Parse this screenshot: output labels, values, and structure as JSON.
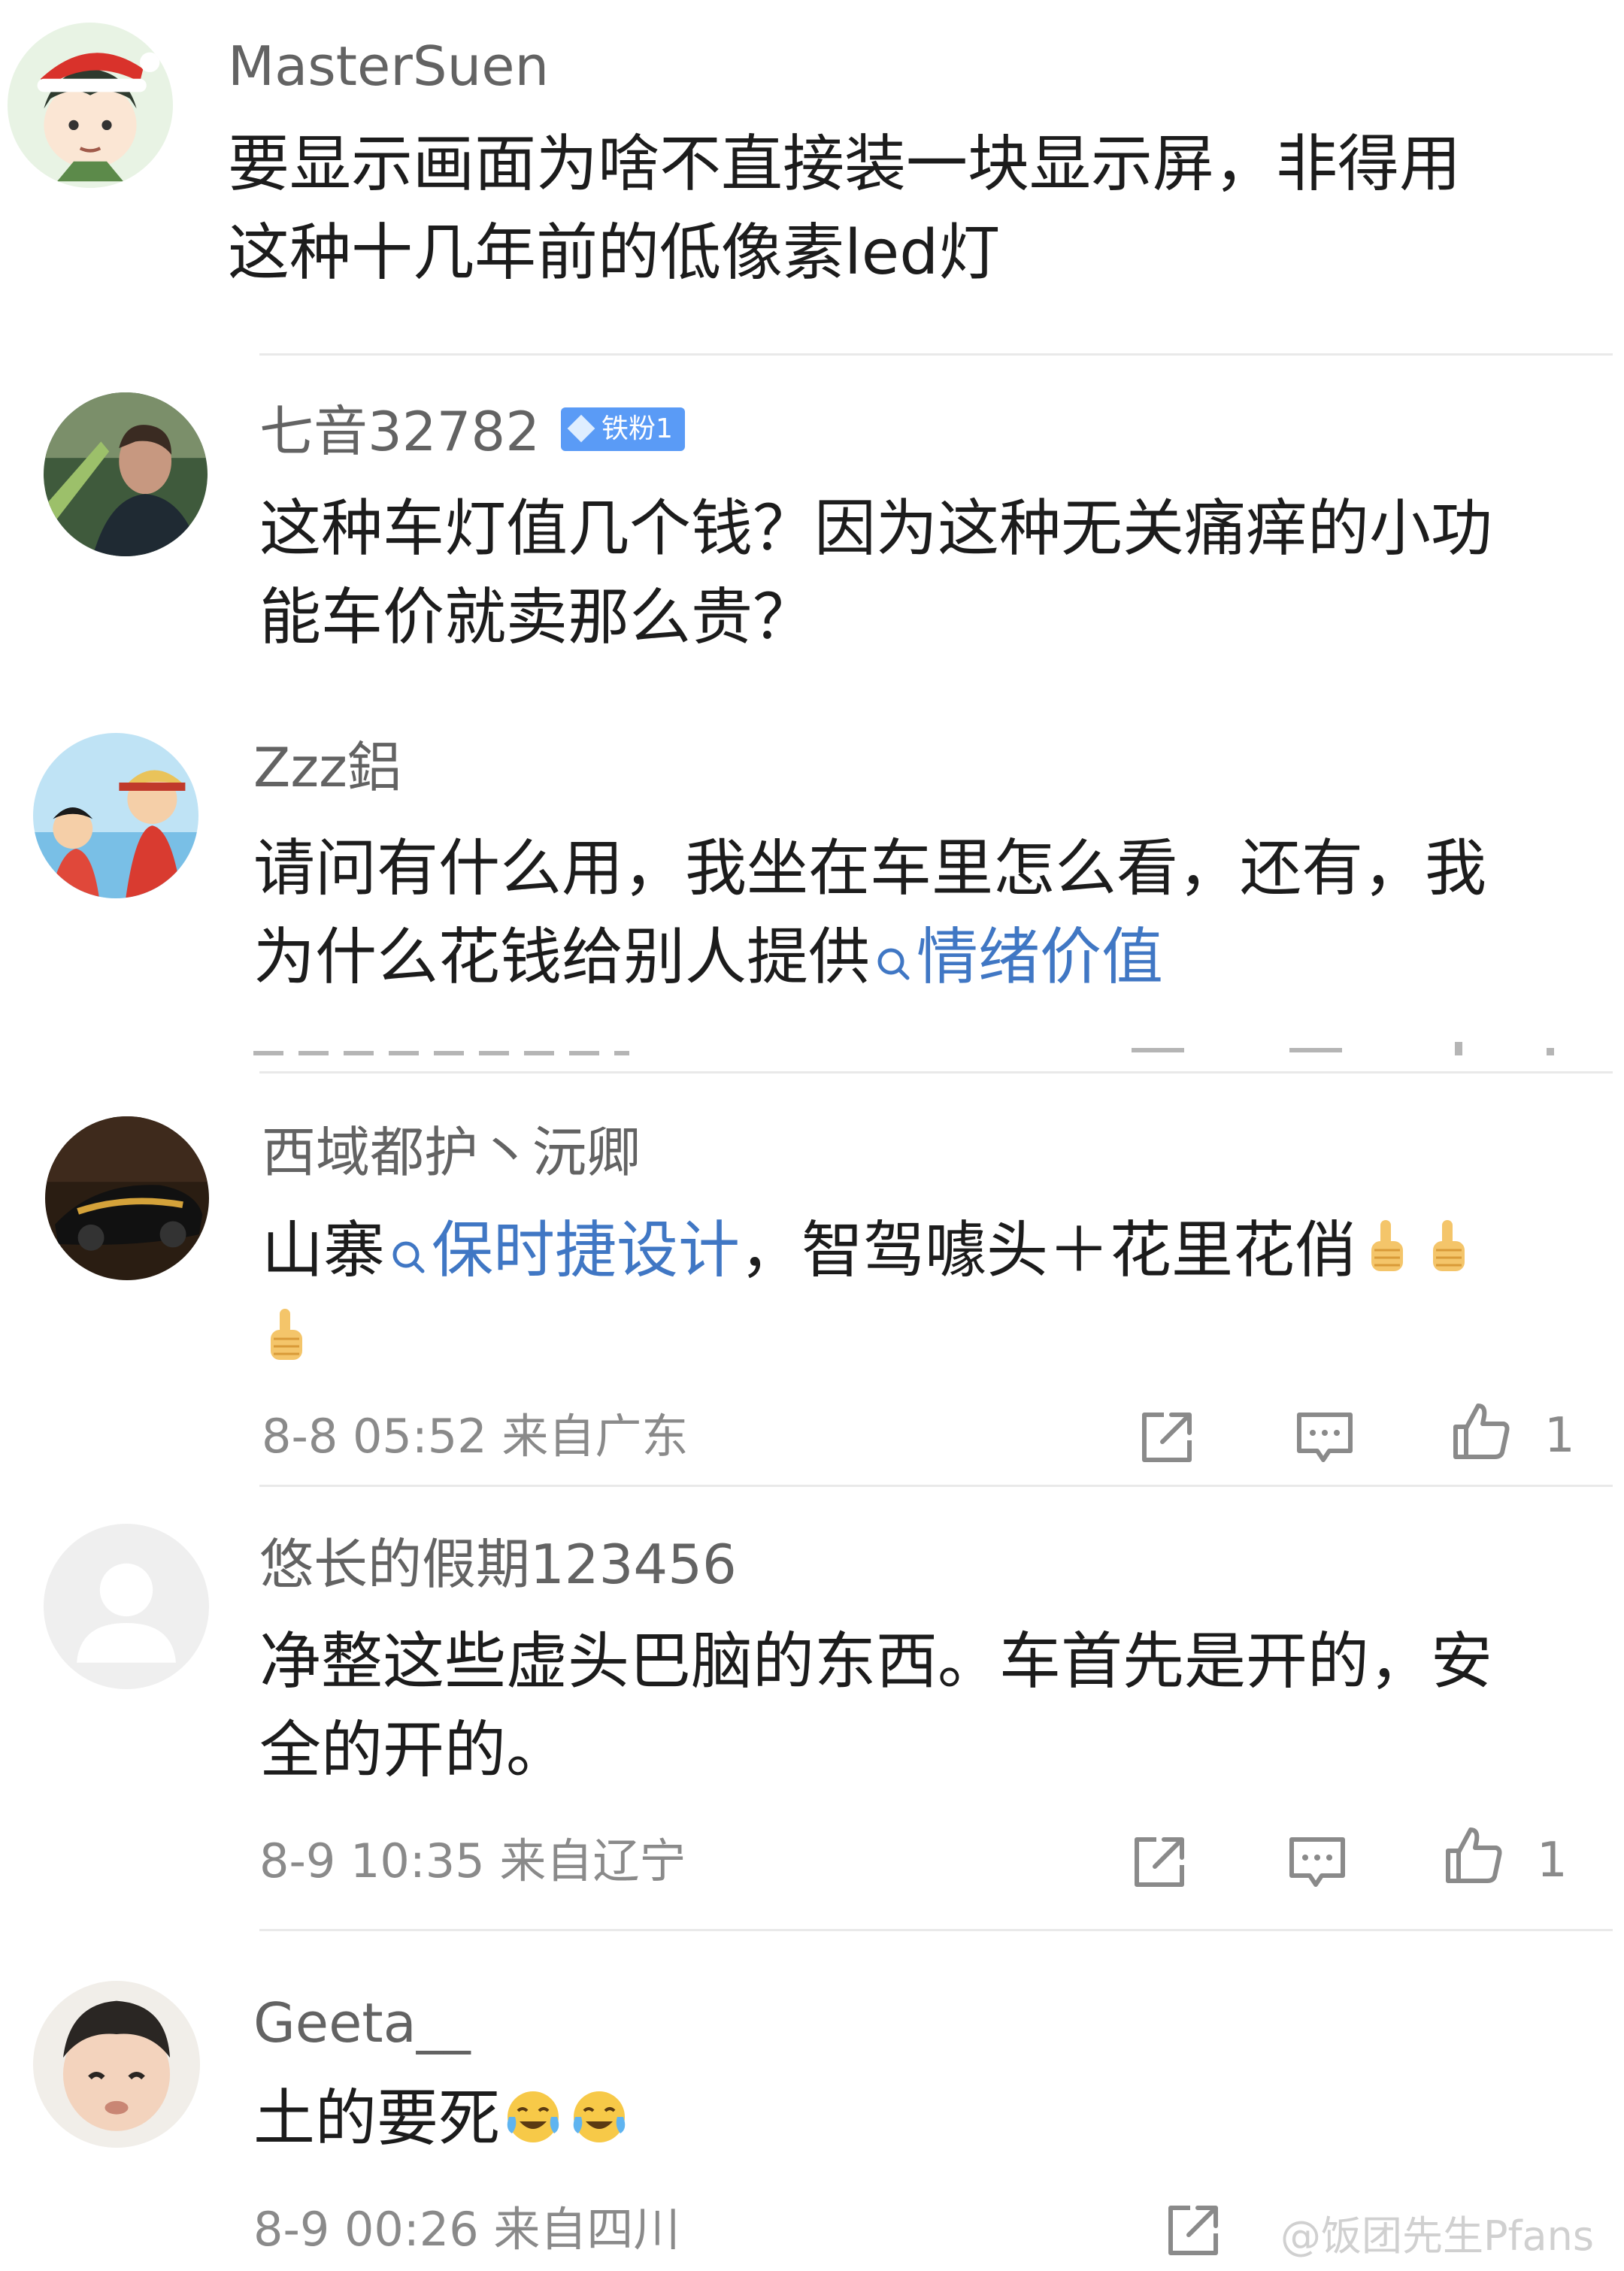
{
  "comments": [
    {
      "user": "MasterSuen",
      "text_lines": [
        "要显示画面为啥不直接装一块显示屏，非得用",
        "这种十几年前的低像素led灯"
      ]
    },
    {
      "user": "七音32782",
      "badge": "铁粉1",
      "text_lines": [
        "这种车灯值几个钱？因为这种无关痛痒的小功",
        "能车价就卖那么贵？"
      ]
    },
    {
      "user": "Zzz鋁",
      "text_line1": "请问有什么用，我坐在车里怎么看，还有，我",
      "text_line2_plain": "为什么花钱给别人提供",
      "text_line2_link": "情绪价值"
    },
    {
      "user": "西域都护丶沅卿",
      "text_prefix": "山寨",
      "text_link": "保时捷设计",
      "text_suffix": "，智驾噱头＋花里花俏",
      "meta": "8-8 05:52 来自广东",
      "likes": "1"
    },
    {
      "user": "悠长的假期123456",
      "text_lines": [
        "净整这些虚头巴脑的东西。车首先是开的，安",
        "全的开的。"
      ],
      "meta": "8-9 10:35 来自辽宁",
      "likes": "1"
    },
    {
      "user": "Geeta__",
      "text": "土的要死",
      "meta": "8-9 00:26 来自四川"
    }
  ],
  "watermark": "@饭团先生Pfans",
  "icons": {
    "share": "share-icon",
    "comment": "comment-icon",
    "like": "thumbs-up-icon",
    "search": "search-icon"
  },
  "colors": {
    "link": "#4077c4",
    "username": "#636363",
    "meta": "#8a8a8a",
    "badge": "#5a9bf6"
  }
}
